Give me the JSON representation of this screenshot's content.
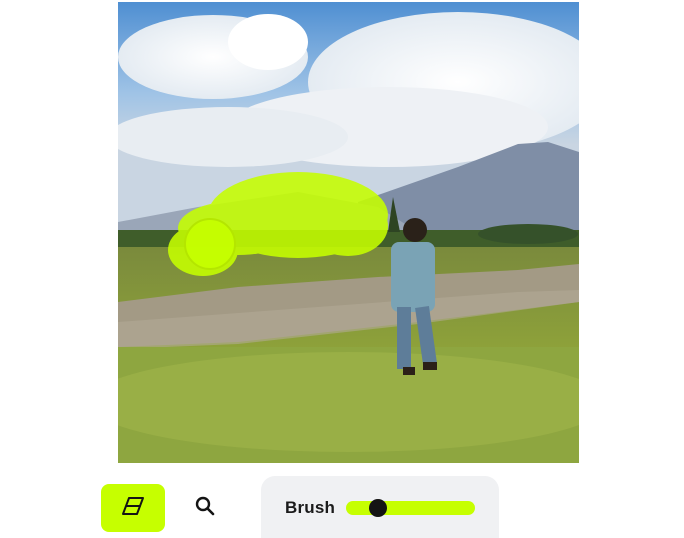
{
  "app": {
    "accent_color": "#c6ff00"
  },
  "canvas": {
    "image_description_icon": "photo-canvas",
    "mask_color": "#c6ff00"
  },
  "toolbar": {
    "eraser": {
      "icon": "eraser-icon",
      "active": true
    },
    "zoom": {
      "icon": "search-icon"
    }
  },
  "brush": {
    "label": "Brush",
    "size_fraction": 0.25
  }
}
